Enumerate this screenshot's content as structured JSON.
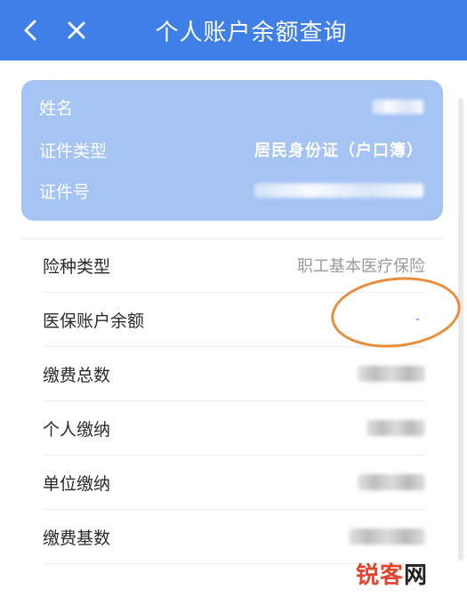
{
  "header": {
    "title": "个人账户余额查询",
    "back_icon": "chevron-left-icon",
    "close_icon": "close-icon"
  },
  "card": {
    "name_label": "姓名",
    "id_type_label": "证件类型",
    "id_type_value": "居民身份证（户口簿）",
    "id_number_label": "证件号"
  },
  "list": {
    "insurance_type_label": "险种类型",
    "insurance_type_value": "职工基本医疗保险",
    "balance_label": "医保账户余额",
    "balance_value": "-",
    "total_payment_label": "缴费总数",
    "personal_payment_label": "个人缴纳",
    "employer_payment_label": "单位缴纳",
    "payment_base_label": "缴费基数"
  },
  "watermark": {
    "part1": "锐",
    "part2": "客",
    "part3": "网"
  },
  "colors": {
    "header_bg": "#3f7fe8",
    "card_bg": "#a5c3f3",
    "annotation": "#e98d3a",
    "watermark_red": "#e0462f"
  }
}
